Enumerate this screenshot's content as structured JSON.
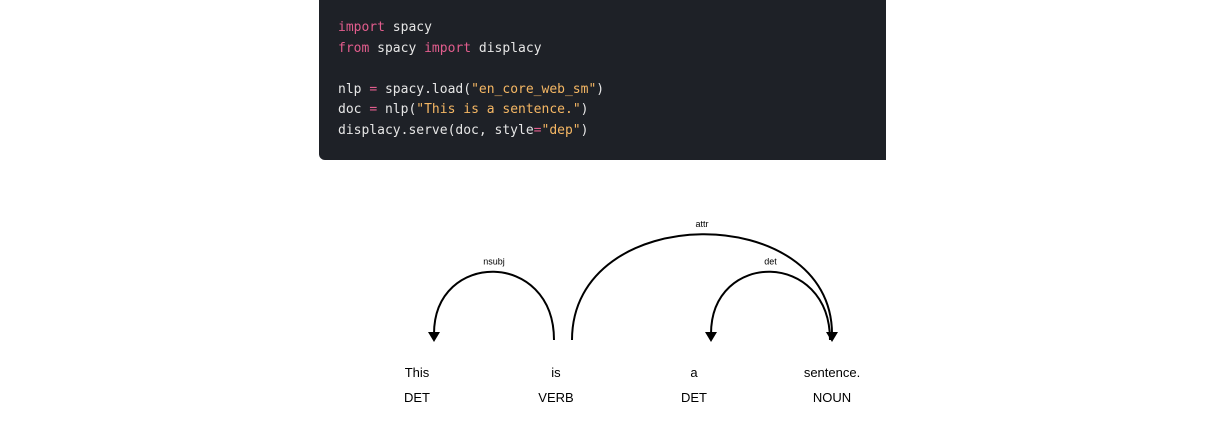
{
  "code": {
    "lines": [
      [
        {
          "t": "kw",
          "v": "import"
        },
        {
          "t": "plain",
          "v": " spacy"
        }
      ],
      [
        {
          "t": "kw",
          "v": "from"
        },
        {
          "t": "plain",
          "v": " spacy "
        },
        {
          "t": "kw",
          "v": "import"
        },
        {
          "t": "plain",
          "v": " displacy"
        }
      ],
      [],
      [
        {
          "t": "plain",
          "v": "nlp "
        },
        {
          "t": "op",
          "v": "="
        },
        {
          "t": "plain",
          "v": " spacy.load("
        },
        {
          "t": "str",
          "v": "\"en_core_web_sm\""
        },
        {
          "t": "plain",
          "v": ")"
        }
      ],
      [
        {
          "t": "plain",
          "v": "doc "
        },
        {
          "t": "op",
          "v": "="
        },
        {
          "t": "plain",
          "v": " nlp("
        },
        {
          "t": "str",
          "v": "\"This is a sentence.\""
        },
        {
          "t": "plain",
          "v": ")"
        }
      ],
      [
        {
          "t": "plain",
          "v": "displacy.serve(doc, style"
        },
        {
          "t": "op",
          "v": "="
        },
        {
          "t": "str",
          "v": "\"dep\""
        },
        {
          "t": "plain",
          "v": ")"
        }
      ]
    ]
  },
  "dependency": {
    "words": [
      {
        "text": "This",
        "tag": "DET"
      },
      {
        "text": "is",
        "tag": "VERB"
      },
      {
        "text": "a",
        "tag": "DET"
      },
      {
        "text": "sentence.",
        "tag": "NOUN"
      }
    ],
    "arcs": [
      {
        "label": "nsubj",
        "from": 1,
        "to": 0
      },
      {
        "label": "attr",
        "from": 1,
        "to": 3
      },
      {
        "label": "det",
        "from": 3,
        "to": 2
      }
    ]
  },
  "colors": {
    "code_background": "#1e2127",
    "code_keyword": "#e25d8d",
    "code_string": "#f5b764",
    "code_text": "#e6e6e6",
    "diagram_ink": "#000000"
  }
}
